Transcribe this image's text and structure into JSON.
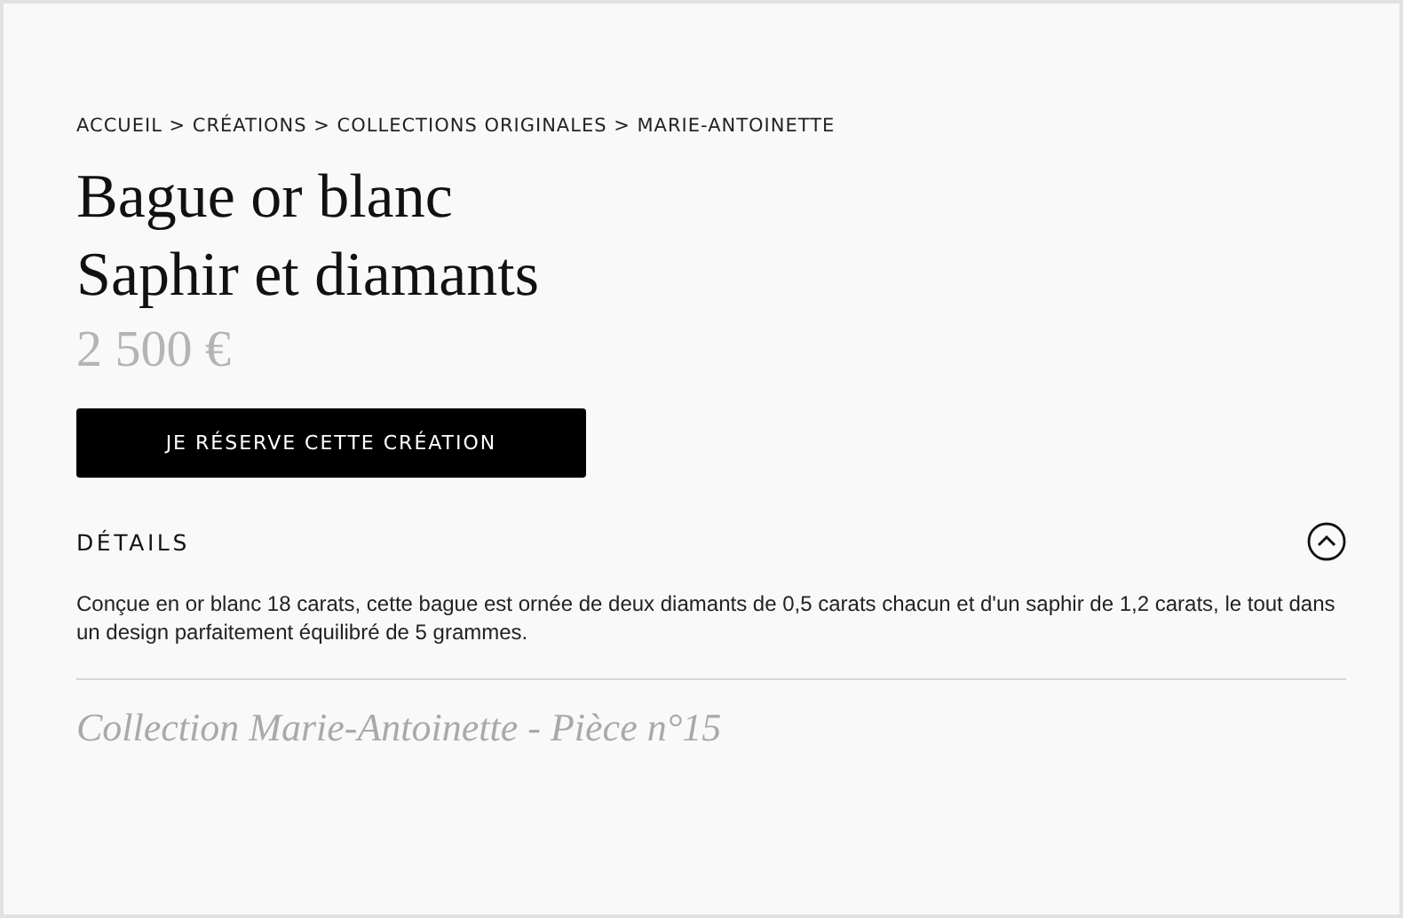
{
  "breadcrumb": "ACCUEIL > CRÉATIONS > COLLECTIONS ORIGINALES > MARIE-ANTOINETTE",
  "title_lines": [
    "Bague or blanc",
    "Saphir et diamants"
  ],
  "price": "2 500 €",
  "reserve_button": "JE RÉSERVE CETTE CRÉATION",
  "details": {
    "heading": "DÉTAILS",
    "expanded": true,
    "text": "Conçue en or blanc 18 carats, cette bague est ornée de deux diamants de 0,5 carats chacun et d'un saphir de 1,2 carats, le tout dans un design parfaitement équilibré de 5 grammes."
  },
  "collection_note": "Collection Marie-Antoinette - Pièce n°15"
}
